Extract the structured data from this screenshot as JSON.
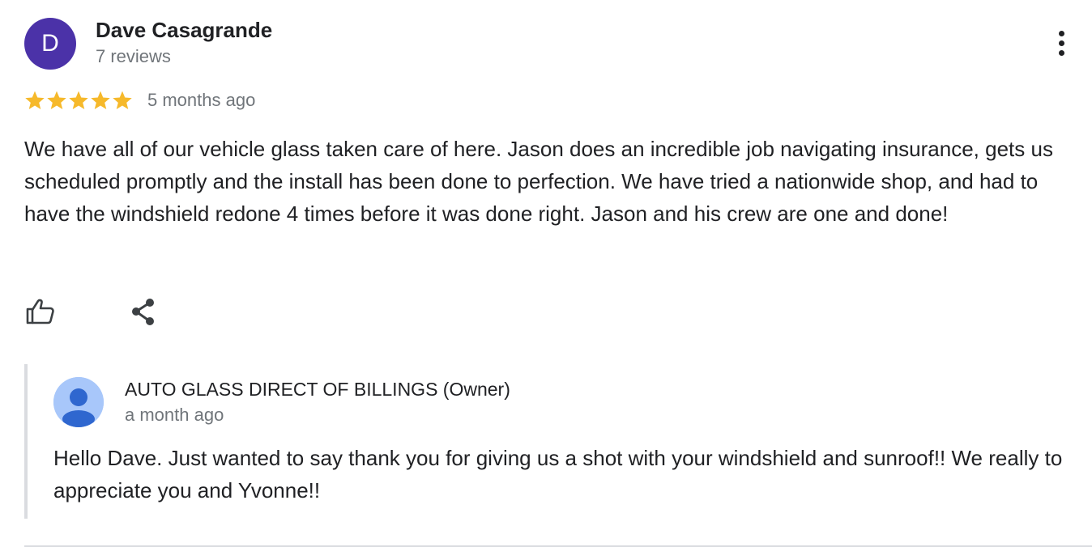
{
  "review": {
    "avatar_letter": "D",
    "avatar_color": "#4b32a8",
    "reviewer_name": "Dave Casagrande",
    "reviewer_meta": "7 reviews",
    "rating": 5,
    "rating_max": 5,
    "star_color": "#f6b92b",
    "date": "5 months ago",
    "text": "We have all of our vehicle glass taken care of here. Jason does an incredible job navigating insurance, gets us scheduled promptly and the install has been done to perfection. We have tried a nationwide shop, and had to have the windshield redone 4 times before it was done right. Jason and his crew are one and done!",
    "more_icon": "more-vert-icon",
    "like_icon": "thumb-up-icon",
    "share_icon": "share-icon"
  },
  "owner_reply": {
    "avatar_icon": "person-icon",
    "avatar_color": "#a8c7fa",
    "name": "AUTO GLASS DIRECT OF BILLINGS (Owner)",
    "date": "a month ago",
    "text": "Hello Dave. Just wanted to say thank you for giving us a shot with your windshield and sunroof!! We really to appreciate you and Yvonne!!"
  }
}
